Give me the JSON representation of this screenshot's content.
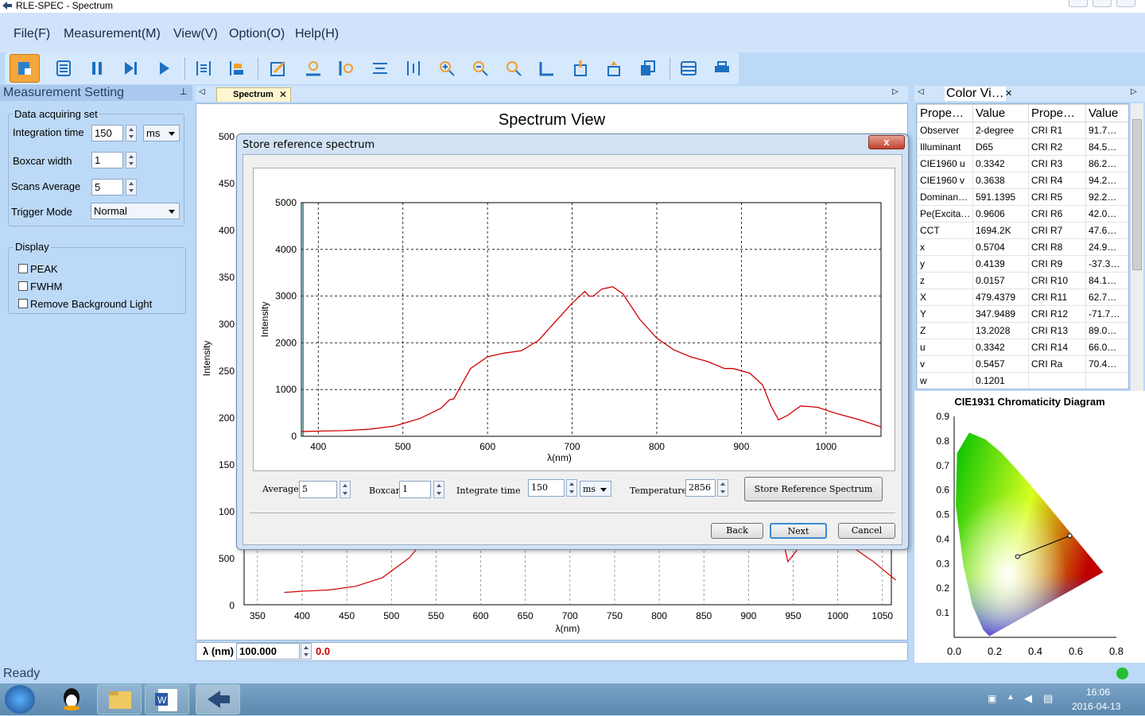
{
  "window": {
    "title": "RLE-SPEC - Spectrum"
  },
  "menu": [
    "File(F)",
    "Measurement(M)",
    "View(V)",
    "Option(O)",
    "Help(H)"
  ],
  "toolbar": {
    "icons": [
      "new-measure-icon",
      "list-icon",
      "pause-icon",
      "step-icon",
      "play-icon",
      "peak-icon",
      "compare-icon",
      "edit-icon",
      "zoom-x-icon",
      "zoom-y-icon",
      "fit-width-icon",
      "fit-height-icon",
      "zoom-in-icon",
      "zoom-out-icon",
      "zoom-reset-icon",
      "chart-icon",
      "export-icon",
      "upload-icon",
      "copy-icon",
      "table-icon",
      "print-icon"
    ]
  },
  "left_panel": {
    "title": "Measurement Setting",
    "acquire_group": "Data acquiring set",
    "integration_label": "Integration time",
    "integration_value": "150",
    "integration_unit": "ms",
    "boxcar_label": "Boxcar width",
    "boxcar_value": "1",
    "scans_label": "Scans Average",
    "scans_value": "5",
    "trigger_label": "Trigger Mode",
    "trigger_value": "Normal",
    "display_group": "Display",
    "checks": [
      "PEAK",
      "FWHM",
      "Remove Background Light"
    ]
  },
  "center": {
    "tab": "Spectrum",
    "title": "Spectrum View",
    "ylabel": "Intensity",
    "xlabel": "λ(nm)",
    "yticks": [
      "500",
      "450",
      "400",
      "350",
      "300",
      "250",
      "200",
      "150",
      "100",
      "500",
      "0"
    ],
    "xticks": [
      "350",
      "400",
      "450",
      "500",
      "550",
      "600",
      "650",
      "700",
      "750",
      "800",
      "850",
      "900",
      "950",
      "1000",
      "1050"
    ],
    "lambda_label": "λ (nm)",
    "lambda_value": "100.000",
    "lambda_result": "0.0"
  },
  "right_panel": {
    "tab": "Color Vi…",
    "headers": [
      "Prope…",
      "Value",
      "Prope…",
      "Value"
    ],
    "rows": [
      [
        "Observer",
        "2-degree",
        "CRI R1",
        "91.7…"
      ],
      [
        "Illuminant",
        "D65",
        "CRI R2",
        "84.5…"
      ],
      [
        "CIE1960 u",
        "0.3342",
        "CRI R3",
        "86.2…"
      ],
      [
        "CIE1960 v",
        "0.3638",
        "CRI R4",
        "94.2…"
      ],
      [
        "Dominan…",
        "591.1395",
        "CRI R5",
        "92.2…"
      ],
      [
        "Pe(Excita…",
        "0.9606",
        "CRI R6",
        "42.0…"
      ],
      [
        "CCT",
        "1694.2K",
        "CRI R7",
        "47.6…"
      ],
      [
        "x",
        "0.5704",
        "CRI R8",
        "24.9…"
      ],
      [
        "y",
        "0.4139",
        "CRI R9",
        "-37.3…"
      ],
      [
        "z",
        "0.0157",
        "CRI R10",
        "84.1…"
      ],
      [
        "X",
        "479.4379",
        "CRI R11",
        "62.7…"
      ],
      [
        "Y",
        "347.9489",
        "CRI R12",
        "-71.7…"
      ],
      [
        "Z",
        "13.2028",
        "CRI R13",
        "89.0…"
      ],
      [
        "u",
        "0.3342",
        "CRI R14",
        "66.0…"
      ],
      [
        "v",
        "0.5457",
        "CRI Ra",
        "70.4…"
      ],
      [
        "w",
        "0.1201",
        "",
        ""
      ]
    ],
    "cie_title": "CIE1931 Chromaticity Diagram",
    "cie_yticks": [
      "0.9",
      "0.8",
      "0.7",
      "0.6",
      "0.5",
      "0.4",
      "0.3",
      "0.2",
      "0.1"
    ],
    "cie_xticks": [
      "0.0",
      "0.2",
      "0.4",
      "0.6",
      "0.8"
    ]
  },
  "dialog": {
    "title": "Store reference spectrum",
    "close": "x",
    "average_label": "Average",
    "average_value": "5",
    "boxcar_label": "Boxcar",
    "boxcar_value": "1",
    "integrate_label": "Integrate time",
    "integrate_value": "150",
    "integrate_unit": "ms",
    "temperature_label": "Temperature",
    "temperature_value": "2856",
    "store_button": "Store Reference Spectrum",
    "back_button": "Back",
    "next_button": "Next",
    "cancel_button": "Cancel"
  },
  "chart_data": [
    {
      "type": "line",
      "title": "",
      "xlabel": "λ(nm)",
      "ylabel": "Intensity",
      "xlim": [
        380,
        1065
      ],
      "ylim": [
        0,
        5000
      ],
      "xticks": [
        400,
        500,
        600,
        700,
        800,
        900,
        1000
      ],
      "yticks": [
        0,
        1000,
        2000,
        3000,
        4000,
        5000
      ],
      "grid": true,
      "marker_line_x": 382,
      "x": [
        380,
        400,
        430,
        460,
        490,
        520,
        545,
        555,
        560,
        580,
        600,
        620,
        640,
        660,
        680,
        700,
        715,
        720,
        725,
        735,
        748,
        760,
        780,
        800,
        820,
        840,
        860,
        880,
        890,
        910,
        925,
        935,
        944,
        955,
        970,
        990,
        1010,
        1040,
        1065
      ],
      "y": [
        100,
        110,
        120,
        150,
        220,
        380,
        600,
        780,
        800,
        1450,
        1700,
        1780,
        1830,
        2050,
        2450,
        2850,
        3100,
        3000,
        3000,
        3150,
        3200,
        3050,
        2500,
        2100,
        1850,
        1700,
        1600,
        1450,
        1450,
        1350,
        1100,
        650,
        350,
        450,
        650,
        620,
        500,
        350,
        200
      ],
      "color": "#d00000"
    },
    {
      "type": "line",
      "title": "Spectrum View",
      "xlabel": "λ(nm)",
      "ylabel": "Intensity",
      "xlim": [
        335,
        1060
      ],
      "xticks": [
        350,
        400,
        450,
        500,
        550,
        600,
        650,
        700,
        750,
        800,
        850,
        900,
        950,
        1000,
        1050
      ],
      "color": "#d00000"
    },
    {
      "type": "scatter",
      "title": "CIE1931 Chromaticity Diagram",
      "xlim": [
        0,
        0.8
      ],
      "ylim": [
        0,
        0.9
      ],
      "point_white": [
        0.3127,
        0.329
      ],
      "point_sample": [
        0.5704,
        0.4139
      ]
    }
  ],
  "status": {
    "text": "Ready"
  },
  "taskbar": {
    "time": "16:06",
    "date": "2016-04-13"
  }
}
